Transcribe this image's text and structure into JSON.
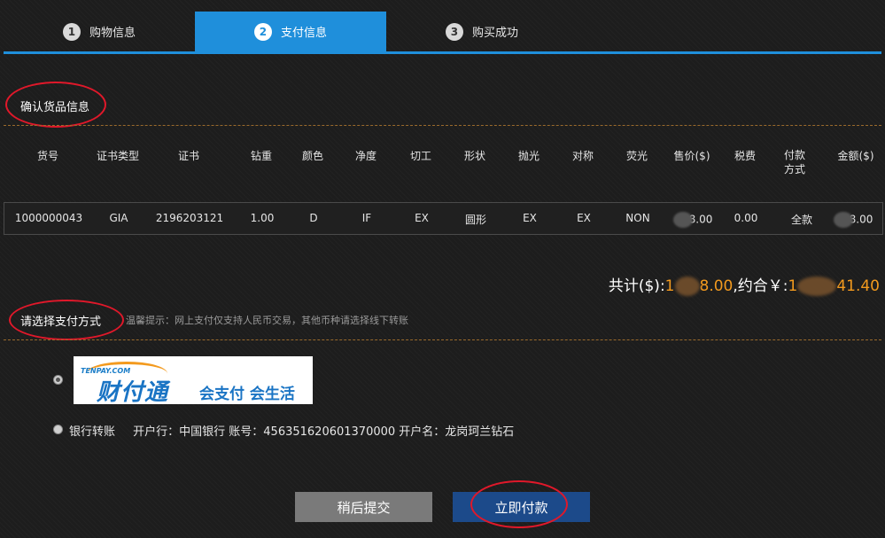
{
  "steps": [
    {
      "num": "1",
      "label": "购物信息",
      "active": false
    },
    {
      "num": "2",
      "label": "支付信息",
      "active": true
    },
    {
      "num": "3",
      "label": "购买成功",
      "active": false
    }
  ],
  "confirm_title": "确认货品信息",
  "table": {
    "headers": [
      "货号",
      "证书类型",
      "证书",
      "钻重",
      "颜色",
      "净度",
      "切工",
      "形状",
      "抛光",
      "对称",
      "荧光",
      "售价($)",
      "税费",
      "付款方式",
      "金额($)"
    ],
    "row": [
      "1000000043",
      "GIA",
      "2196203121",
      "1.00",
      "D",
      "IF",
      "EX",
      "圆形",
      "EX",
      "EX",
      "NON",
      "8.00",
      "0.00",
      "全款",
      "8.00"
    ]
  },
  "total": {
    "label1": "共计($):",
    "usd_prefix": "1",
    "usd_suffix": "8.00",
    "label2": ",约合￥:",
    "cny_prefix": "1",
    "cny_suffix": "41.40"
  },
  "payment_title": "请选择支付方式",
  "tip": "温馨提示：网上支付仅支持人民币交易，其他币种请选择线下转账",
  "tenpay": {
    "small": "TENPAY.COM",
    "brand": "财付通",
    "slogan": "会支付 会生活"
  },
  "bank": {
    "label": "银行转账",
    "details": "开户行：中国银行 账号：456351620601370000 开户名：龙岗珂兰钻石"
  },
  "buttons": {
    "later": "稍后提交",
    "pay": "立即付款"
  },
  "colors": {
    "accent": "#1f8fdb",
    "amount": "#f39a1e",
    "annotation": "#e0182a"
  }
}
